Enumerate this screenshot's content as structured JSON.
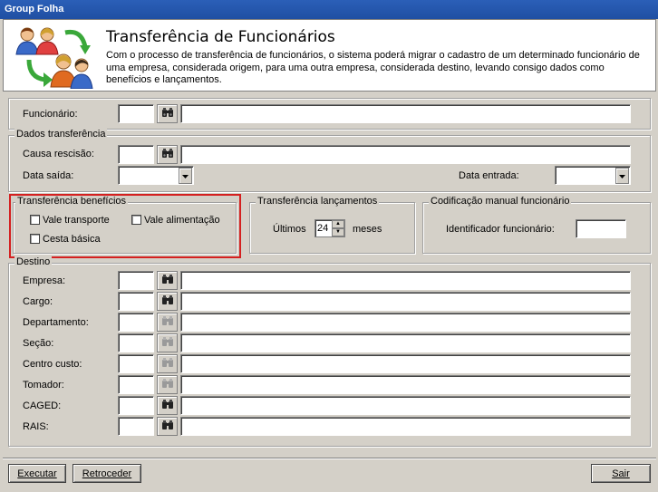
{
  "window": {
    "title": "Group Folha"
  },
  "header": {
    "title": "Transferência de Funcionários",
    "description": "Com o processo de transferência de funcionários, o sistema poderá migrar o cadastro de um determinado funcionário de uma empresa, considerada origem, para uma outra empresa, considerada destino, levando consigo dados como benefícios e lançamentos."
  },
  "funcionario": {
    "label": "Funcionário:",
    "code": "",
    "name": ""
  },
  "dados_transferencia": {
    "title": "Dados transferência",
    "causa_label": "Causa rescisão:",
    "causa_code": "",
    "causa_name": "",
    "data_saida_label": "Data saída:",
    "data_saida_value": "",
    "data_entrada_label": "Data entrada:",
    "data_entrada_value": ""
  },
  "transferencia_beneficios": {
    "title": "Transferência benefícios",
    "vale_transporte": "Vale transporte",
    "vale_alimentacao": "Vale alimentação",
    "cesta_basica": "Cesta básica"
  },
  "transferencia_lancamentos": {
    "title": "Transferência lançamentos",
    "ultimos_label": "Últimos",
    "meses_value": "24",
    "meses_label": "meses"
  },
  "codificacao": {
    "title": "Codificação manual funcionário",
    "identificador_label": "Identificador funcionário:",
    "identificador_value": ""
  },
  "destino": {
    "title": "Destino",
    "rows": [
      {
        "label": "Empresa:",
        "code": "",
        "name": "",
        "enabled": true
      },
      {
        "label": "Cargo:",
        "code": "",
        "name": "",
        "enabled": true
      },
      {
        "label": "Departamento:",
        "code": "",
        "name": "",
        "enabled": false
      },
      {
        "label": "Seção:",
        "code": "",
        "name": "",
        "enabled": false
      },
      {
        "label": "Centro custo:",
        "code": "",
        "name": "",
        "enabled": false
      },
      {
        "label": "Tomador:",
        "code": "",
        "name": "",
        "enabled": false
      },
      {
        "label": "CAGED:",
        "code": "",
        "name": "",
        "enabled": true
      },
      {
        "label": "RAIS:",
        "code": "",
        "name": "",
        "enabled": true
      }
    ]
  },
  "footer": {
    "executar": "Executar",
    "retroceder": "Retroceder",
    "sair": "Sair"
  },
  "icons": {
    "header_logo": "users-transfer-icon",
    "lookup": "binoculars-icon",
    "combo": "chevron-down-icon"
  },
  "colors": {
    "titlebar": "#2b5fb8",
    "background": "#d4d0c8",
    "highlight": "#d42020"
  }
}
